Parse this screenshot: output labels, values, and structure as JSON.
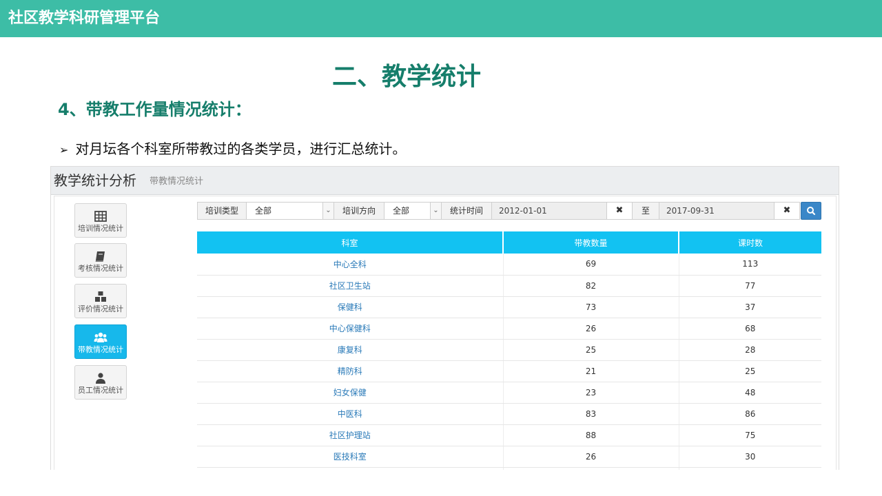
{
  "top_bar": {
    "title": "社区教学科研管理平台"
  },
  "headings": {
    "main": "二、教学统计",
    "sub": "4、带教工作量情况统计：",
    "bullet_arrow": "➢",
    "bullet": "对月坛各个科室所带教过的各类学员，进行汇总统计。"
  },
  "screenshot": {
    "header_title": "教学统计分析",
    "header_sub": "带教情况统计",
    "nav": [
      {
        "label": "培训情况统计",
        "icon": "table-icon",
        "active": false
      },
      {
        "label": "考核情况统计",
        "icon": "book-icon",
        "active": false
      },
      {
        "label": "评价情况统计",
        "icon": "cubes-icon",
        "active": false
      },
      {
        "label": "带教情况统计",
        "icon": "users-icon",
        "active": true
      },
      {
        "label": "员工情况统计",
        "icon": "user-icon",
        "active": false
      }
    ],
    "filters": {
      "type_label": "培训类型",
      "type_value": "全部",
      "direction_label": "培训方向",
      "direction_value": "全部",
      "time_label": "统计时间",
      "start_date": "2012-01-01",
      "to_label": "至",
      "end_date": "2017-09-31",
      "clear_glyph": "✖"
    },
    "table": {
      "headers": [
        "科室",
        "带教数量",
        "课时数"
      ],
      "rows": [
        [
          "中心全科",
          "69",
          "113"
        ],
        [
          "社区卫生站",
          "82",
          "77"
        ],
        [
          "保健科",
          "73",
          "37"
        ],
        [
          "中心保健科",
          "26",
          "68"
        ],
        [
          "康复科",
          "25",
          "28"
        ],
        [
          "精防科",
          "21",
          "25"
        ],
        [
          "妇女保健",
          "23",
          "48"
        ],
        [
          "中医科",
          "83",
          "86"
        ],
        [
          "社区护理站",
          "88",
          "75"
        ],
        [
          "医技科室",
          "26",
          "30"
        ]
      ]
    }
  },
  "colors": {
    "brand_teal": "#3dbda6",
    "heading_green": "#167e6b",
    "table_header": "#12c2f2",
    "active_nav": "#17b8eb",
    "link_blue": "#2a7ab8"
  }
}
